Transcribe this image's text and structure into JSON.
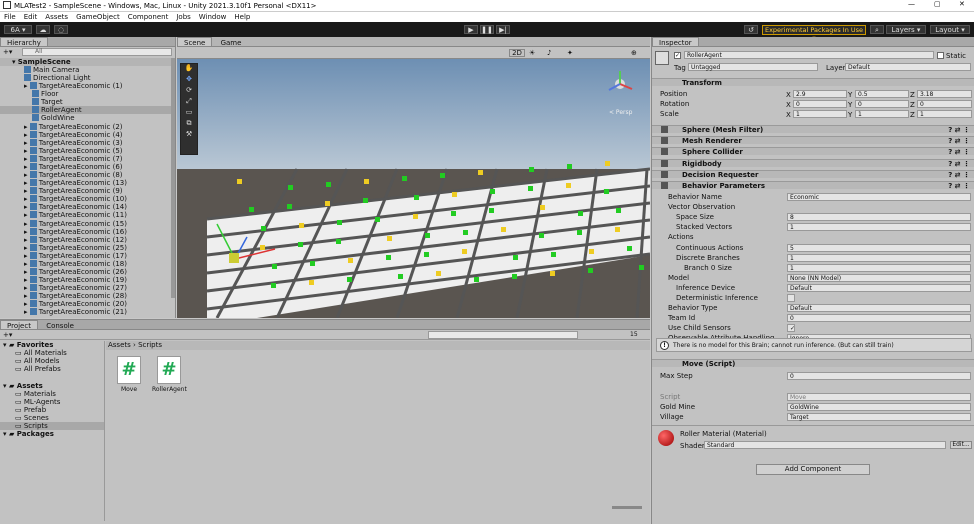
{
  "window": {
    "title": "MLATest2 - SampleScene - Windows, Mac, Linux - Unity 2021.3.10f1 Personal <DX11>"
  },
  "menu": [
    "File",
    "Edit",
    "Assets",
    "GameObject",
    "Component",
    "Jobs",
    "Window",
    "Help"
  ],
  "toolbar": {
    "account": "6A",
    "experimental": "Experimental Packages In Use ▾",
    "layers": "Layers",
    "layout": "Layout"
  },
  "hierarchy": {
    "tab": "Hierarchy",
    "search_placeholder": "All",
    "scene": "SampleScene",
    "items": [
      {
        "label": "Main Camera",
        "indent": 2,
        "sel": false
      },
      {
        "label": "Directional Light",
        "indent": 2,
        "sel": false
      },
      {
        "label": "TargetAreaEconomic (1)",
        "indent": 2,
        "sel": false
      },
      {
        "label": "Floor",
        "indent": 3,
        "sel": false
      },
      {
        "label": "Target",
        "indent": 3,
        "sel": false
      },
      {
        "label": "RollerAgent",
        "indent": 3,
        "sel": true
      },
      {
        "label": "GoldWine",
        "indent": 3,
        "sel": false
      },
      {
        "label": "TargetAreaEconomic (2)",
        "indent": 2,
        "sel": false
      },
      {
        "label": "TargetAreaEconomic (4)",
        "indent": 2,
        "sel": false
      },
      {
        "label": "TargetAreaEconomic (3)",
        "indent": 2,
        "sel": false
      },
      {
        "label": "TargetAreaEconomic (5)",
        "indent": 2,
        "sel": false
      },
      {
        "label": "TargetAreaEconomic (7)",
        "indent": 2,
        "sel": false
      },
      {
        "label": "TargetAreaEconomic (6)",
        "indent": 2,
        "sel": false
      },
      {
        "label": "TargetAreaEconomic (8)",
        "indent": 2,
        "sel": false
      },
      {
        "label": "TargetAreaEconomic (13)",
        "indent": 2,
        "sel": false
      },
      {
        "label": "TargetAreaEconomic (9)",
        "indent": 2,
        "sel": false
      },
      {
        "label": "TargetAreaEconomic (10)",
        "indent": 2,
        "sel": false
      },
      {
        "label": "TargetAreaEconomic (14)",
        "indent": 2,
        "sel": false
      },
      {
        "label": "TargetAreaEconomic (11)",
        "indent": 2,
        "sel": false
      },
      {
        "label": "TargetAreaEconomic (15)",
        "indent": 2,
        "sel": false
      },
      {
        "label": "TargetAreaEconomic (16)",
        "indent": 2,
        "sel": false
      },
      {
        "label": "TargetAreaEconomic (12)",
        "indent": 2,
        "sel": false
      },
      {
        "label": "TargetAreaEconomic (25)",
        "indent": 2,
        "sel": false
      },
      {
        "label": "TargetAreaEconomic (17)",
        "indent": 2,
        "sel": false
      },
      {
        "label": "TargetAreaEconomic (18)",
        "indent": 2,
        "sel": false
      },
      {
        "label": "TargetAreaEconomic (26)",
        "indent": 2,
        "sel": false
      },
      {
        "label": "TargetAreaEconomic (19)",
        "indent": 2,
        "sel": false
      },
      {
        "label": "TargetAreaEconomic (27)",
        "indent": 2,
        "sel": false
      },
      {
        "label": "TargetAreaEconomic (28)",
        "indent": 2,
        "sel": false
      },
      {
        "label": "TargetAreaEconomic (20)",
        "indent": 2,
        "sel": false
      },
      {
        "label": "TargetAreaEconomic (21)",
        "indent": 2,
        "sel": false
      }
    ]
  },
  "scene": {
    "tab_scene": "Scene",
    "tab_game": "Game",
    "mode_2d": "2D",
    "persp": "< Persp"
  },
  "project": {
    "tab_project": "Project",
    "tab_console": "Console",
    "path_assets": "Assets",
    "path_sep": "›",
    "path_scripts": "Scripts",
    "count": "15",
    "tree": [
      {
        "label": "Favorites",
        "indent": 0,
        "bold": true,
        "sel": false
      },
      {
        "label": "All Materials",
        "indent": 2,
        "bold": false,
        "sel": false
      },
      {
        "label": "All Models",
        "indent": 2,
        "bold": false,
        "sel": false
      },
      {
        "label": "All Prefabs",
        "indent": 2,
        "bold": false,
        "sel": false
      },
      {
        "label": "",
        "indent": 0,
        "bold": false,
        "sel": false
      },
      {
        "label": "Assets",
        "indent": 0,
        "bold": true,
        "sel": false
      },
      {
        "label": "Materials",
        "indent": 2,
        "bold": false,
        "sel": false
      },
      {
        "label": "ML-Agents",
        "indent": 2,
        "bold": false,
        "sel": false
      },
      {
        "label": "Prefab",
        "indent": 2,
        "bold": false,
        "sel": false
      },
      {
        "label": "Scenes",
        "indent": 2,
        "bold": false,
        "sel": false
      },
      {
        "label": "Scripts",
        "indent": 2,
        "bold": false,
        "sel": true
      },
      {
        "label": "Packages",
        "indent": 0,
        "bold": true,
        "sel": false
      }
    ],
    "files": [
      {
        "label": "Move"
      },
      {
        "label": "RollerAgent"
      }
    ]
  },
  "inspector": {
    "tab": "Inspector",
    "name": "RollerAgent",
    "static": "Static",
    "tag_label": "Tag",
    "tag": "Untagged",
    "layer_label": "Layer",
    "layer": "Default",
    "transform": {
      "title": "Transform",
      "position": "Position",
      "rotation": "Rotation",
      "scale": "Scale",
      "pos": [
        "2.9",
        "0.5",
        "3.18"
      ],
      "rot": [
        "0",
        "0",
        "0"
      ],
      "scl": [
        "1",
        "1",
        "1"
      ],
      "xyz": [
        "X",
        "Y",
        "Z"
      ]
    },
    "components": [
      "Sphere (Mesh Filter)",
      "Mesh Renderer",
      "Sphere Collider",
      "Rigidbody",
      "Decision Requester",
      "Behavior Parameters"
    ],
    "bp": [
      {
        "label": "Behavior Name",
        "value": "Economic",
        "indent": 0
      },
      {
        "label": "Vector Observation",
        "value": "",
        "indent": 0
      },
      {
        "label": "Space Size",
        "value": "8",
        "indent": 1
      },
      {
        "label": "Stacked Vectors",
        "value": "1",
        "indent": 1
      },
      {
        "label": "Actions",
        "value": "",
        "indent": 0
      },
      {
        "label": "Continuous Actions",
        "value": "5",
        "indent": 1
      },
      {
        "label": "Discrete Branches",
        "value": "1",
        "indent": 1
      },
      {
        "label": "Branch 0 Size",
        "value": "1",
        "indent": 2
      },
      {
        "label": "Model",
        "value": "None (NN Model)",
        "indent": 0
      },
      {
        "label": "Inference Device",
        "value": "Default",
        "indent": 1
      },
      {
        "label": "Deterministic Inference",
        "value": "",
        "indent": 1
      },
      {
        "label": "Behavior Type",
        "value": "Default",
        "indent": 0
      },
      {
        "label": "Team Id",
        "value": "0",
        "indent": 0
      },
      {
        "label": "Use Child Sensors",
        "value": "✓",
        "indent": 0
      },
      {
        "label": "Observable Attribute Handling",
        "value": "Ignore",
        "indent": 0
      }
    ],
    "warning": "There is no model for this Brain; cannot run inference. (But can still train)",
    "move": {
      "title": "Move (Script)",
      "max_step_label": "Max Step",
      "max_step": "0",
      "script_label": "Script",
      "script": "Move",
      "gold_label": "Gold Mine",
      "gold": "GoldWine",
      "village_label": "Village",
      "village": "Target"
    },
    "material": {
      "title": "Roller Material (Material)",
      "shader_label": "Shader",
      "shader": "Standard",
      "edit": "Edit..."
    },
    "add_component": "Add Component"
  }
}
